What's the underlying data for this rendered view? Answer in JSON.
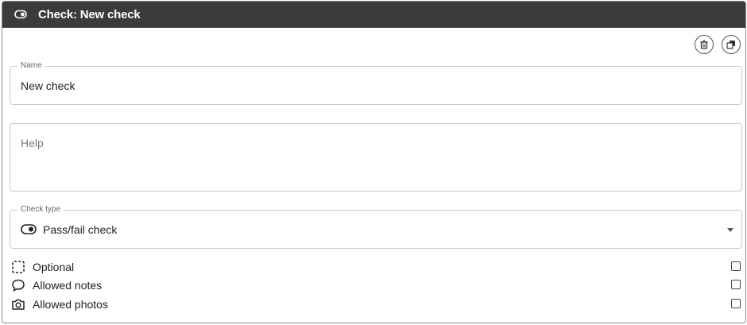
{
  "header": {
    "title": "Check: New check",
    "icon": "eye-toggle-icon"
  },
  "actions": {
    "delete_icon": "trash-icon",
    "copy_icon": "copy-icon"
  },
  "name_field": {
    "label": "Name",
    "value": "New check"
  },
  "help_field": {
    "placeholder": "Help"
  },
  "check_type": {
    "label": "Check type",
    "value": "Pass/fail check",
    "icon": "toggle-icon"
  },
  "options": [
    {
      "label": "Optional",
      "icon": "dashed-square-icon",
      "checked": false
    },
    {
      "label": "Allowed notes",
      "icon": "speech-bubble-icon",
      "checked": false
    },
    {
      "label": "Allowed photos",
      "icon": "camera-icon",
      "checked": false
    }
  ],
  "colors": {
    "header_bg": "#3b3b3b",
    "header_text": "#ffffff"
  }
}
